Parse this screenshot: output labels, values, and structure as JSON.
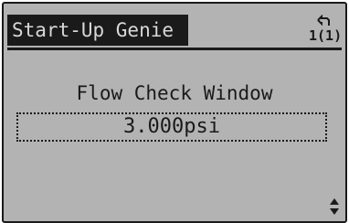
{
  "header": {
    "title": "Start-Up Genie",
    "back_icon": "back-arrow-icon",
    "page_indicator": "1(1)"
  },
  "main": {
    "parameter_label": "Flow Check Window",
    "parameter_value": "3.000psi"
  },
  "footer": {
    "scroll_icon": "up-down-arrows-icon"
  },
  "colors": {
    "screen_background": "#b3b3b3",
    "foreground": "#1a1a1a",
    "title_text": "#d8d8d8"
  }
}
